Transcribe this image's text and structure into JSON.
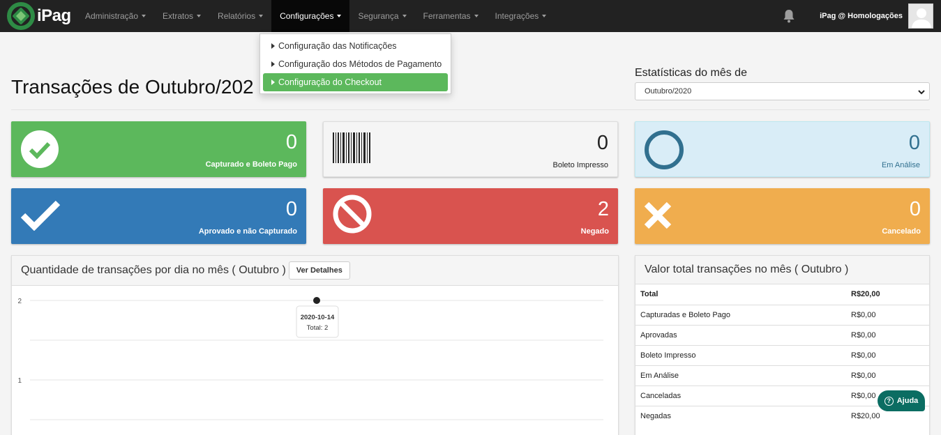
{
  "nav": {
    "brand": "iPag",
    "items": [
      {
        "label": "Administração"
      },
      {
        "label": "Extratos"
      },
      {
        "label": "Relatórios"
      },
      {
        "label": "Configurações"
      },
      {
        "label": "Segurança"
      },
      {
        "label": "Ferramentas"
      },
      {
        "label": "Integrações"
      }
    ],
    "active": "Configurações",
    "user": "iPag @ Homologações"
  },
  "dropdown": {
    "items": [
      {
        "label": "Configuração das Notificações"
      },
      {
        "label": "Configuração dos Métodos de Pagamento"
      },
      {
        "label": "Configuração do Checkout"
      }
    ],
    "selected": "Configuração do Checkout"
  },
  "header": {
    "title": "Transações de Outubro/202",
    "stats_label": "Estatísticas do mês de",
    "stats_selected": "Outubro/2020"
  },
  "cards": [
    {
      "value": "0",
      "label": "Capturado e Boleto Pago",
      "color": "#5cb85c",
      "icon": "check-circle-icon"
    },
    {
      "value": "0",
      "label": "Boleto Impresso",
      "color": "#f5f5f5",
      "icon": "barcode-icon"
    },
    {
      "value": "0",
      "label": "Em Análise",
      "color": "#d9edf7",
      "icon": "circle-outline-icon"
    },
    {
      "value": "0",
      "label": "Aprovado e não Capturado",
      "color": "#337ab7",
      "icon": "check-icon"
    },
    {
      "value": "2",
      "label": "Negado",
      "color": "#d9534f",
      "icon": "ban-icon"
    },
    {
      "value": "0",
      "label": "Cancelado",
      "color": "#f0ad4e",
      "icon": "times-icon"
    }
  ],
  "chart_panel": {
    "title": "Quantidade de transações por dia no mês ( Outubro )",
    "details_button": "Ver Detalhes"
  },
  "chart_data": {
    "type": "line",
    "x": [
      "2020-10-14"
    ],
    "series": [
      {
        "values": [
          2
        ]
      }
    ],
    "yticks": [
      "2",
      "1"
    ],
    "tooltip": {
      "date": "2020-10-14",
      "text": "Total: 2"
    }
  },
  "totals_panel": {
    "title": "Valor total transações no mês ( Outubro )",
    "rows": [
      {
        "label": "Total",
        "value": "R$20,00"
      },
      {
        "label": "Capturadas e Boleto Pago",
        "value": "R$0,00"
      },
      {
        "label": "Aprovadas",
        "value": "R$0,00"
      },
      {
        "label": "Boleto Impresso",
        "value": "R$0,00"
      },
      {
        "label": "Em Análise",
        "value": "R$0,00"
      },
      {
        "label": "Canceladas",
        "value": "R$0,00"
      },
      {
        "label": "Negadas",
        "value": "R$20,00"
      }
    ]
  },
  "help": {
    "label": "Ajuda"
  }
}
